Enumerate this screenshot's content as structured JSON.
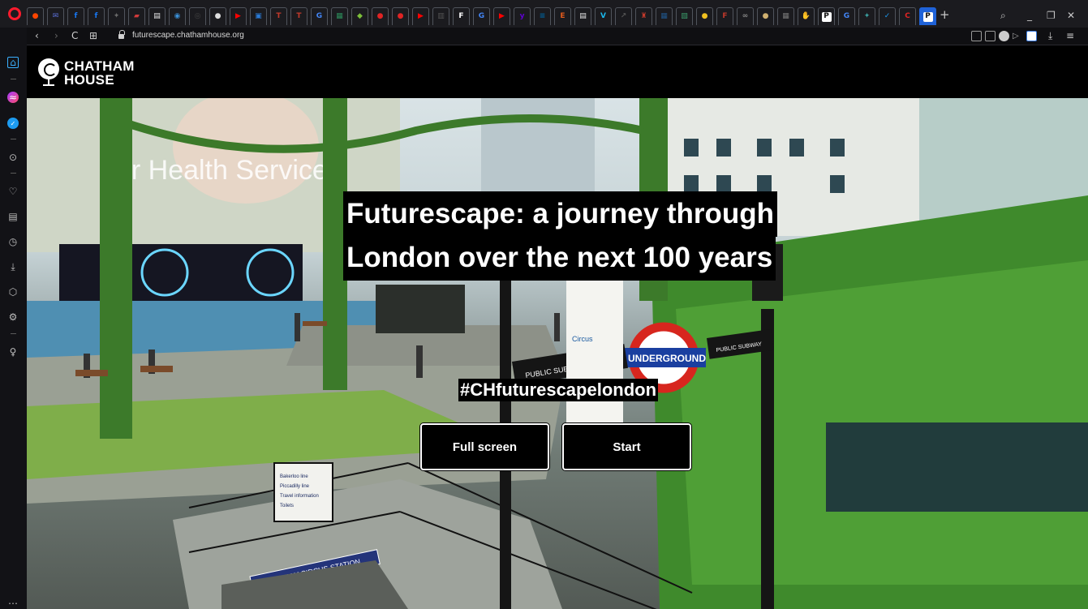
{
  "browser": {
    "url": "futurescape.chathamhouse.org",
    "tabs": [
      {
        "icon": "reddit-icon",
        "color": "#ff4500",
        "glyph": "●"
      },
      {
        "icon": "mail-icon",
        "color": "#5a6fd6",
        "glyph": "✉"
      },
      {
        "icon": "facebook-icon",
        "color": "#1877f2",
        "glyph": "f"
      },
      {
        "icon": "facebook-icon",
        "color": "#1877f2",
        "glyph": "f"
      },
      {
        "icon": "puzzle-icon",
        "color": "#6a6a6a",
        "glyph": "✦"
      },
      {
        "icon": "bookmark-icon",
        "color": "#d03a3a",
        "glyph": "▰"
      },
      {
        "icon": "doc-icon",
        "color": "#e8e8e8",
        "glyph": "▤"
      },
      {
        "icon": "globe-icon",
        "color": "#3a8fd6",
        "glyph": "◉"
      },
      {
        "icon": "circle-icon",
        "color": "#444",
        "glyph": "◎"
      },
      {
        "icon": "ball-icon",
        "color": "#dddddd",
        "glyph": "●"
      },
      {
        "icon": "youtube-icon",
        "color": "#ff0000",
        "glyph": "▶"
      },
      {
        "icon": "image-icon",
        "color": "#2a7ad6",
        "glyph": "▣"
      },
      {
        "icon": "letter-t-icon",
        "color": "#c0392b",
        "glyph": "T"
      },
      {
        "icon": "letter-t-icon",
        "color": "#c0392b",
        "glyph": "T"
      },
      {
        "icon": "google-icon",
        "color": "#4285f4",
        "glyph": "G"
      },
      {
        "icon": "photo-icon",
        "color": "#2c8c5a",
        "glyph": "▦"
      },
      {
        "icon": "leaf-icon",
        "color": "#7cbf3a",
        "glyph": "◆"
      },
      {
        "icon": "drop-icon",
        "color": "#e02424",
        "glyph": "●"
      },
      {
        "icon": "drop-icon",
        "color": "#e02424",
        "glyph": "●"
      },
      {
        "icon": "youtube-icon",
        "color": "#ff0000",
        "glyph": "▶"
      },
      {
        "icon": "news-icon",
        "color": "#555",
        "glyph": "▥"
      },
      {
        "icon": "letter-f-icon",
        "color": "#ffffff",
        "glyph": "F"
      },
      {
        "icon": "google-icon",
        "color": "#4285f4",
        "glyph": "G"
      },
      {
        "icon": "youtube-icon",
        "color": "#ff0000",
        "glyph": "▶"
      },
      {
        "icon": "yahoo-icon",
        "color": "#6001d2",
        "glyph": "y"
      },
      {
        "icon": "ieee-icon",
        "color": "#00629b",
        "glyph": "≡"
      },
      {
        "icon": "letter-e-icon",
        "color": "#e05a1c",
        "glyph": "E"
      },
      {
        "icon": "doc-icon",
        "color": "#e8e8e8",
        "glyph": "▤"
      },
      {
        "icon": "vimeo-icon",
        "color": "#1ab7ea",
        "glyph": "V"
      },
      {
        "icon": "chart-icon",
        "color": "#555",
        "glyph": "↗"
      },
      {
        "icon": "crest-icon",
        "color": "#c0392b",
        "glyph": "♜"
      },
      {
        "icon": "nih-icon",
        "color": "#20558a",
        "glyph": "▦"
      },
      {
        "icon": "map-icon",
        "color": "#3a9a6a",
        "glyph": "▧"
      },
      {
        "icon": "bulb-icon",
        "color": "#f0c020",
        "glyph": "●"
      },
      {
        "icon": "letter-f-icon",
        "color": "#c0392b",
        "glyph": "F"
      },
      {
        "icon": "link-icon",
        "color": "#888",
        "glyph": "∞"
      },
      {
        "icon": "moon-icon",
        "color": "#d0b070",
        "glyph": "●"
      },
      {
        "icon": "grid-icon",
        "color": "#777",
        "glyph": "▦"
      },
      {
        "icon": "hand-icon",
        "color": "#d08a3a",
        "glyph": "✋"
      },
      {
        "icon": "pinterest-icon",
        "color": "#e60023",
        "glyph": "P"
      },
      {
        "icon": "google-icon",
        "color": "#4285f4",
        "glyph": "G"
      },
      {
        "icon": "bird-icon",
        "color": "#3aa0a0",
        "glyph": "✦"
      },
      {
        "icon": "twitter-icon",
        "color": "#1d9bf0",
        "glyph": "✓"
      },
      {
        "icon": "refresh-icon",
        "color": "#e02424",
        "glyph": "C"
      },
      {
        "icon": "letter-p-icon",
        "color": "#111111",
        "glyph": "P"
      }
    ],
    "new_tab": "+",
    "window_controls": {
      "search": "⌕",
      "minimize": "_",
      "restore": "❐",
      "close": "✕"
    },
    "nav": {
      "back": "‹",
      "forward": "›",
      "reload": "C",
      "speed_dial": "⊞"
    },
    "toolbar_right": {
      "download": "⤓",
      "menu": "≡"
    },
    "sidebar_icons": [
      "home-icon",
      "messenger-icon",
      "twitter-icon",
      "player-icon",
      "heart-icon",
      "news-icon",
      "history-icon",
      "downloads-icon",
      "cube-icon",
      "settings-icon",
      "bulb-icon",
      "more-icon"
    ]
  },
  "site": {
    "logo_line1": "CHATHAM",
    "logo_line2": "HOUSE",
    "title_line1": "Futurescape: a journey through",
    "title_line2": "London over the next 100 years",
    "hashtag": "#CHfuturescapelondon",
    "fullscreen_label": "Full screen",
    "start_label": "Start"
  },
  "scene_text": {
    "banner_text": "ur Health Service",
    "underground": "UNDERGROUND",
    "public_subway_left": "PUBLIC SUBWAY",
    "public_subway_right": "PUBLIC SUBWAY",
    "station_name": "PICCADILLY CIRCUS STATION",
    "sign_lines": [
      "Bakerloo line",
      "Piccadilly line",
      "Travel information",
      "Toilets"
    ],
    "circus_sign": "Circus"
  }
}
